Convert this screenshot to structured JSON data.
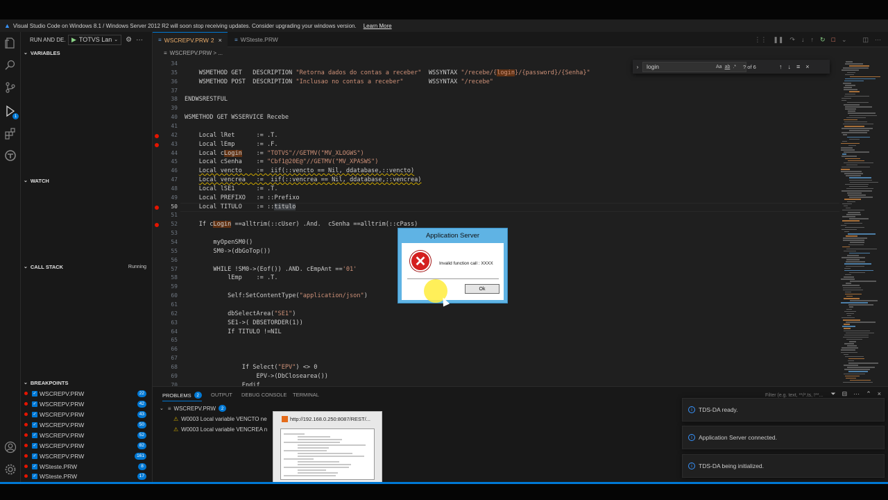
{
  "banner": {
    "message": "Visual Studio Code on Windows 8.1 / Windows Server 2012 R2 will soon stop receiving updates. Consider upgrading your windows version.",
    "link": "Learn More"
  },
  "activity_bar": {
    "debug_badge": "1"
  },
  "sidebar": {
    "run_title": "RUN AND DE...",
    "launch_config": "TOTVS Lan",
    "variables_label": "VARIABLES",
    "watch_label": "WATCH",
    "callstack_label": "CALL STACK",
    "callstack_state": "Running",
    "breakpoints_label": "BREAKPOINTS",
    "breakpoints": [
      {
        "file": "WSCREPV.PRW",
        "line": "22"
      },
      {
        "file": "WSCREPV.PRW",
        "line": "42"
      },
      {
        "file": "WSCREPV.PRW",
        "line": "43"
      },
      {
        "file": "WSCREPV.PRW",
        "line": "50"
      },
      {
        "file": "WSCREPV.PRW",
        "line": "52"
      },
      {
        "file": "WSCREPV.PRW",
        "line": "82"
      },
      {
        "file": "WSCREPV.PRW",
        "line": "161"
      },
      {
        "file": "WSteste.PRW",
        "line": "8"
      },
      {
        "file": "WSteste.PRW",
        "line": "17"
      }
    ]
  },
  "tabs": [
    {
      "label": "WSCREPV.PRW",
      "dirty": "2",
      "close": "×"
    },
    {
      "label": "WSteste.PRW"
    }
  ],
  "breadcrumb": "WSCREPV.PRW > ...",
  "find": {
    "query": "login",
    "count": "? of 6",
    "opt_case": "Aa",
    "opt_word": "ab",
    "opt_regex": ".*"
  },
  "editor": {
    "lines": [
      {
        "n": "34",
        "html": ""
      },
      {
        "n": "35",
        "html": "    WSMETHOD GET   DESCRIPTION <span class='str'>\"Retorna dados do contas a receber\"</span>  WSSYNTAX <span class='str'>\"/recebe/{<span class='hl'>login</span>}/{password}/{Senha}\"</span>"
      },
      {
        "n": "36",
        "html": "    WSMETHOD POST  DESCRIPTION <span class='str'>\"Inclusao no contas a receber\"</span>       WSSYNTAX <span class='str'>\"/recebe\"</span>"
      },
      {
        "n": "37",
        "html": ""
      },
      {
        "n": "38",
        "html": "ENDWSRESTFUL"
      },
      {
        "n": "39",
        "html": ""
      },
      {
        "n": "40",
        "html": "WSMETHOD GET WSSERVICE Recebe"
      },
      {
        "n": "41",
        "html": ""
      },
      {
        "n": "42",
        "html": "    Local lRet      := .T.",
        "bp": true
      },
      {
        "n": "43",
        "html": "    Local lEmp      := .F.",
        "bp": true
      },
      {
        "n": "44",
        "html": "    Local c<span class='hl'>Login</span>    := <span class='str'>\"TOTVS\"</span><span class='cm'>//GETMV(\"MV_XLOGWS\")</span>"
      },
      {
        "n": "45",
        "html": "    Local cSenha    := <span class='str'>\"Cbf1@20E@\"</span><span class='cm'>//GETMV(\"MV_XPASWS\")</span>"
      },
      {
        "n": "46",
        "html": "    <span class='warnline'>Local vencto    :=  iif(::vencto == Nil, ddatabase,::vencto)</span>"
      },
      {
        "n": "47",
        "html": "    <span class='warnline'>Local vencrea   :=  iif(::vencrea == Nil, ddatabase,::vencrea)</span>"
      },
      {
        "n": "48",
        "html": "    Local lSE1      := .T."
      },
      {
        "n": "49",
        "html": "    Local PREFIXO   := ::Prefixo"
      },
      {
        "n": "50",
        "html": "    Local TITULO    := ::<span class='sel'>titulo</span>",
        "bp": true,
        "cur": true
      },
      {
        "n": "51",
        "html": ""
      },
      {
        "n": "52",
        "html": "    If c<span class='hl'>Login</span> ==alltrim(::cUser) .And.  cSenha ==alltrim(::cPass)",
        "bp": true
      },
      {
        "n": "53",
        "html": ""
      },
      {
        "n": "54",
        "html": "        myOpenSM0()"
      },
      {
        "n": "55",
        "html": "        SM0->(dbGoTop())"
      },
      {
        "n": "56",
        "html": ""
      },
      {
        "n": "57",
        "html": "        WHILE !SM0->(Eof()) .AND. cEmpAnt ==<span class='str'>'01'</span>"
      },
      {
        "n": "58",
        "html": "            lEmp    := .T."
      },
      {
        "n": "59",
        "html": ""
      },
      {
        "n": "60",
        "html": "            Self:SetContentType(<span class='str'>\"application/json\"</span>)"
      },
      {
        "n": "61",
        "html": ""
      },
      {
        "n": "62",
        "html": "            dbSelectArea(<span class='str'>\"SE1\"</span>)"
      },
      {
        "n": "63",
        "html": "            SE1->( DBSETORDER(1))"
      },
      {
        "n": "64",
        "html": "            If TITULO !=NIL"
      },
      {
        "n": "65",
        "html": ""
      },
      {
        "n": "66",
        "html": ""
      },
      {
        "n": "67",
        "html": ""
      },
      {
        "n": "68",
        "html": "                If Select(<span class='str'>\"EPV\"</span>) <> 0"
      },
      {
        "n": "69",
        "html": "                    EPV->(DbClosearea())"
      },
      {
        "n": "70",
        "html": "                Endif"
      }
    ]
  },
  "dialog": {
    "title": "Application Server",
    "message": "Invalid function call : XXXX",
    "ok": "Ok"
  },
  "panel": {
    "tabs": [
      {
        "label": "PROBLEMS",
        "count": "2"
      },
      {
        "label": "OUTPUT"
      },
      {
        "label": "DEBUG CONSOLE"
      },
      {
        "label": "TERMINAL"
      }
    ],
    "filter_placeholder": "Filter (e.g. text, **/*.ts, !**...",
    "file": "WSCREPV.PRW",
    "file_count": "2",
    "problems": [
      "W0003 Local variable VENCTO ne",
      "W0003 Local variable VENCREA n"
    ]
  },
  "notifications": [
    "TDS-DA ready.",
    "Application Server connected.",
    "TDS-DA being initialized."
  ],
  "taskbar_thumb": {
    "title": "http://192.168.0.250:8087/REST/..."
  },
  "colors": {
    "accent": "#0078d4",
    "breakpoint": "#e51400",
    "editor_bg": "#1f1f1f",
    "sidebar_bg": "#181818",
    "dialog_frame": "#5fb3e4"
  }
}
